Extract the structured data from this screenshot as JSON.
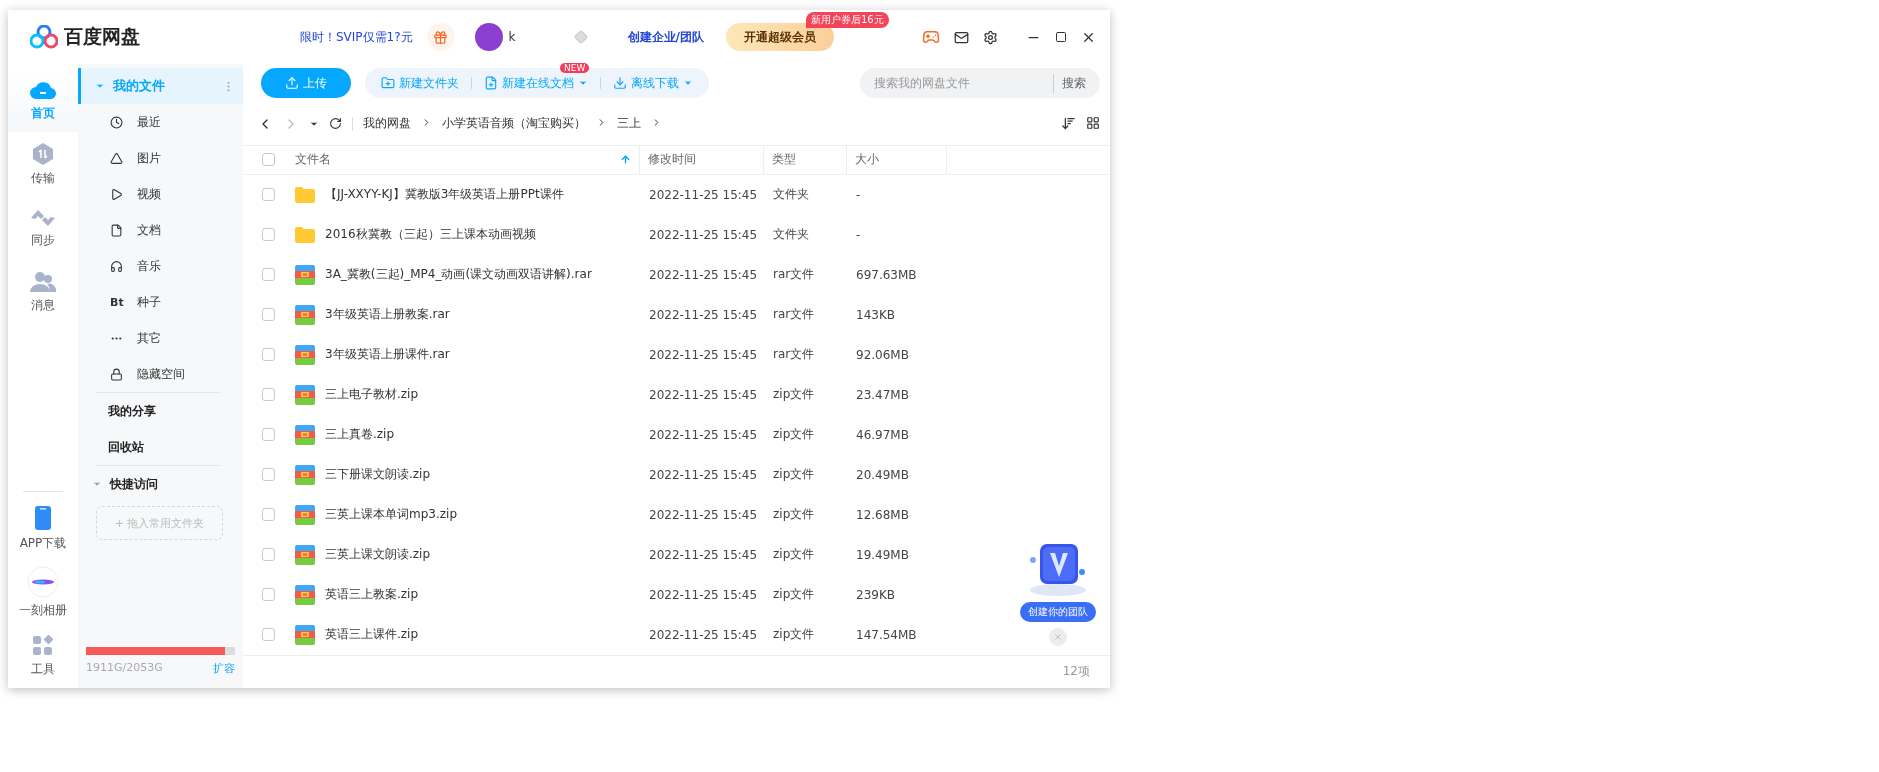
{
  "app": {
    "name": "百度网盘"
  },
  "header": {
    "promo": "限时！SVIP仅需1?元",
    "user": "k",
    "team_link": "创建企业/团队",
    "vip_button": "开通超级会员",
    "vip_badge": "新用户券后16元"
  },
  "rail": {
    "top": [
      {
        "kind": "cloud",
        "label": "首页",
        "selected": true
      },
      {
        "kind": "transfer",
        "label": "传输",
        "selected": false
      },
      {
        "kind": "sync",
        "label": "同步",
        "selected": false
      },
      {
        "kind": "people",
        "label": "消息",
        "selected": false
      }
    ],
    "bottom": [
      {
        "kind": "phone",
        "label": "APP下载",
        "selected": false
      },
      {
        "kind": "album",
        "label": "一刻相册",
        "selected": false
      },
      {
        "kind": "tools",
        "label": "工具",
        "selected": false
      }
    ]
  },
  "nav": {
    "my_files": {
      "label": "我的文件",
      "expanded": true,
      "selected": true
    },
    "items": [
      {
        "kind": "clock",
        "label": "最近",
        "selected": false
      },
      {
        "kind": "image",
        "label": "图片",
        "selected": false
      },
      {
        "kind": "video",
        "label": "视频",
        "selected": false
      },
      {
        "kind": "doc",
        "label": "文档",
        "selected": false
      },
      {
        "kind": "music",
        "label": "音乐",
        "selected": false
      },
      {
        "kind": "text",
        "glyph": "Bt",
        "label": "种子",
        "selected": false
      },
      {
        "kind": "more",
        "label": "其它",
        "selected": false
      },
      {
        "kind": "lock",
        "label": "隐藏空间",
        "selected": false
      }
    ],
    "links": [
      {
        "label": "我的分享",
        "selected": false
      },
      {
        "label": "回收站",
        "selected": false
      }
    ],
    "quick_access": {
      "label": "快捷访问",
      "expanded": true,
      "drop_hint": "+ 拖入常用文件夹"
    }
  },
  "storage": {
    "level": 0.93,
    "reading": "1911G/2053G",
    "expand": "扩容"
  },
  "toolbar": {
    "upload": "上传",
    "new_folder": "新建文件夹",
    "new_doc": "新建在线文档",
    "new_badge": "NEW",
    "offline": "离线下载",
    "search": {
      "placeholder": "搜索我的网盘文件",
      "button": "搜索"
    }
  },
  "breadcrumb": [
    "我的网盘",
    "小学英语音频（淘宝购买）",
    "三上"
  ],
  "table": {
    "select_all": {
      "checked": false
    },
    "columns": [
      {
        "label": "文件名",
        "sorted": true
      },
      {
        "label": "修改时间",
        "sorted": false
      },
      {
        "label": "类型",
        "sorted": false
      },
      {
        "label": "大小",
        "sorted": false
      }
    ],
    "rows": [
      {
        "kind": "folder",
        "checked": false,
        "name": "【JJ-XXYY-KJ】冀教版3年级英语上册PPt课件",
        "modified": "2022-11-25 15:45",
        "type": "文件夹",
        "size": "-"
      },
      {
        "kind": "folder",
        "checked": false,
        "name": "2016秋冀教（三起）三上课本动画视频",
        "modified": "2022-11-25 15:45",
        "type": "文件夹",
        "size": "-"
      },
      {
        "kind": "archive",
        "checked": false,
        "name": "3A_冀教(三起)_MP4_动画(课文动画双语讲解).rar",
        "modified": "2022-11-25 15:45",
        "type": "rar文件",
        "size": "697.63MB"
      },
      {
        "kind": "archive",
        "checked": false,
        "name": "3年级英语上册教案.rar",
        "modified": "2022-11-25 15:45",
        "type": "rar文件",
        "size": "143KB"
      },
      {
        "kind": "archive",
        "checked": false,
        "name": "3年级英语上册课件.rar",
        "modified": "2022-11-25 15:45",
        "type": "rar文件",
        "size": "92.06MB"
      },
      {
        "kind": "archive",
        "checked": false,
        "name": "三上电子教材.zip",
        "modified": "2022-11-25 15:45",
        "type": "zip文件",
        "size": "23.47MB"
      },
      {
        "kind": "archive",
        "checked": false,
        "name": "三上真卷.zip",
        "modified": "2022-11-25 15:45",
        "type": "zip文件",
        "size": "46.97MB"
      },
      {
        "kind": "archive",
        "checked": false,
        "name": "三下册课文朗读.zip",
        "modified": "2022-11-25 15:45",
        "type": "zip文件",
        "size": "20.49MB"
      },
      {
        "kind": "archive",
        "checked": false,
        "name": "三英上课本单词mp3.zip",
        "modified": "2022-11-25 15:45",
        "type": "zip文件",
        "size": "12.68MB"
      },
      {
        "kind": "archive",
        "checked": false,
        "name": "三英上课文朗读.zip",
        "modified": "2022-11-25 15:45",
        "type": "zip文件",
        "size": "19.49MB"
      },
      {
        "kind": "archive",
        "checked": false,
        "name": "英语三上教案.zip",
        "modified": "2022-11-25 15:45",
        "type": "zip文件",
        "size": "239KB"
      },
      {
        "kind": "archive",
        "checked": false,
        "name": "英语三上课件.zip",
        "modified": "2022-11-25 15:45",
        "type": "zip文件",
        "size": "147.54MB"
      }
    ]
  },
  "footer": {
    "count": "12项"
  },
  "team_widget": {
    "label": "创建你的团队"
  }
}
